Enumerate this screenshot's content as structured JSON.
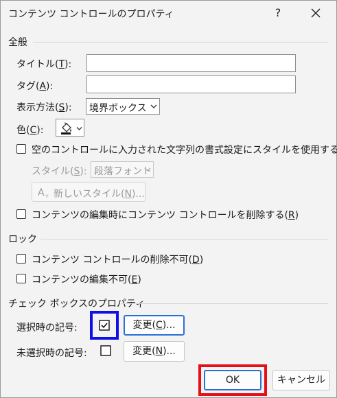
{
  "window": {
    "title": "コンテンツ コントロールのプロパティ",
    "help_label": "?"
  },
  "general": {
    "heading": "全般",
    "title_label": "タイトル(",
    "title_key": "T",
    "title_field_value": "",
    "tag_label": "タグ(",
    "tag_key": "A",
    "tag_field_value": "",
    "display_label": "表示方法(",
    "display_key": "S",
    "display_value": "境界ボックス",
    "color_label": "色(",
    "color_key": "C",
    "style_check_label": "空のコントロールに入力された文字列の書式設定にスタイルを使用する(",
    "style_check_key": "U",
    "style_check_checked": false,
    "style_label": "スタイル(",
    "style_key": "S",
    "style_value": "段落フォント",
    "new_style_label": "新しいスタイル(",
    "new_style_key": "N",
    "new_style_suffix": ")...",
    "remove_check_label": "コンテンツの編集時にコンテンツ コントロールを削除する(",
    "remove_check_key": "R",
    "remove_check_checked": false
  },
  "lock": {
    "heading": "ロック",
    "cannot_delete_label": "コンテンツ コントロールの削除不可(",
    "cannot_delete_key": "D",
    "cannot_delete_checked": false,
    "cannot_edit_label": "コンテンツの編集不可(",
    "cannot_edit_key": "E",
    "cannot_edit_checked": false
  },
  "checkbox_props": {
    "heading": "チェック ボックスのプロパティ",
    "checked_symbol_label": "選択時の記号:",
    "checked_symbol": "☑",
    "checked_change_label": "変更(",
    "checked_change_key": "C",
    "checked_change_suffix": ")...",
    "unchecked_symbol_label": "未選択時の記号:",
    "unchecked_symbol": "☐",
    "unchecked_change_label": "変更(",
    "unchecked_change_key": "N",
    "unchecked_change_suffix": ")..."
  },
  "footer": {
    "ok_label": "OK",
    "cancel_label": "キャンセル"
  },
  "colors": {
    "highlight_blue": "#1010e6",
    "highlight_red": "#e60f15",
    "primary_border": "#2a6fd6"
  },
  "icons": [
    "close-icon",
    "chevron-down-icon",
    "paint-bucket-icon",
    "checkbox-icon",
    "new-style-icon"
  ]
}
